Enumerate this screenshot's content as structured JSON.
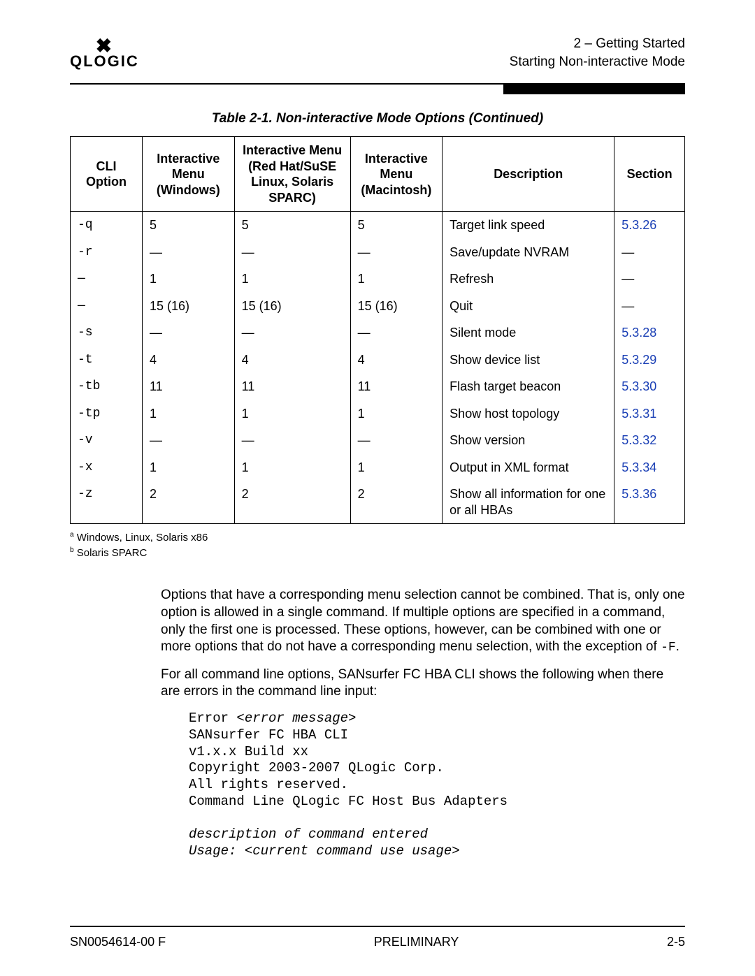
{
  "header": {
    "logo_text": "QLOGIC",
    "crumb1": "2 – Getting Started",
    "crumb2": "Starting Non-interactive Mode"
  },
  "table": {
    "caption": "Table 2-1. Non-interactive Mode Options (Continued)",
    "columns": {
      "cli1": "CLI",
      "cli2": "Option",
      "win1": "Interactive",
      "win2": "Menu",
      "win3": "(Windows)",
      "lin1": "Interactive Menu",
      "lin2": "(Red Hat/SuSE",
      "lin3": "Linux, Solaris",
      "lin4": "SPARC)",
      "mac1": "Interactive",
      "mac2": "Menu",
      "mac3": "(Macintosh)",
      "desc": "Description",
      "sec": "Section"
    },
    "rows": [
      {
        "cli": "-q",
        "win": "5",
        "lin": "5",
        "mac": "5",
        "desc": "Target link speed",
        "sec": "5.3.26",
        "link": true
      },
      {
        "cli": "-r",
        "win": "—",
        "lin": "—",
        "mac": "—",
        "desc": "Save/update NVRAM",
        "sec": "—",
        "link": false
      },
      {
        "cli": "—",
        "win": "1",
        "lin": "1",
        "mac": "1",
        "desc": "Refresh",
        "sec": "—",
        "link": false
      },
      {
        "cli": "—",
        "win": "15 (16)",
        "lin": "15 (16)",
        "mac": "15 (16)",
        "desc": "Quit",
        "sec": "—",
        "link": false
      },
      {
        "cli": "-s",
        "win": "—",
        "lin": "—",
        "mac": "—",
        "desc": "Silent mode",
        "sec": "5.3.28",
        "link": true
      },
      {
        "cli": "-t",
        "win": "4",
        "lin": "4",
        "mac": "4",
        "desc": "Show device list",
        "sec": "5.3.29",
        "link": true
      },
      {
        "cli": "-tb",
        "win": "11",
        "lin": "11",
        "mac": "11",
        "desc": "Flash target beacon",
        "sec": "5.3.30",
        "link": true
      },
      {
        "cli": "-tp",
        "win": "1",
        "lin": "1",
        "mac": "1",
        "desc": "Show host topology",
        "sec": "5.3.31",
        "link": true
      },
      {
        "cli": "-v",
        "win": "—",
        "lin": "—",
        "mac": "—",
        "desc": "Show version",
        "sec": "5.3.32",
        "link": true
      },
      {
        "cli": "-x",
        "win": "1",
        "lin": "1",
        "mac": "1",
        "desc": "Output in XML format",
        "sec": "5.3.34",
        "link": true
      },
      {
        "cli": "-z",
        "win": "2",
        "lin": "2",
        "mac": "2",
        "desc": "Show all information for one or all HBAs",
        "sec": "5.3.36",
        "link": true
      }
    ]
  },
  "footnotes": {
    "a": "Windows, Linux, Solaris x86",
    "b": "Solaris SPARC"
  },
  "paragraphs": {
    "p1_a": "Options that have a corresponding menu selection cannot be combined. That is, only one option is allowed in a single command. If multiple options are specified in a command, only the first one is processed. These options, however, can be combined with one or more options that do not have a corresponding menu selection, with the exception of ",
    "p1_code": "-F",
    "p1_b": ".",
    "p2": "For all command line options, SANsurfer FC HBA CLI shows the following when there are errors in the command line input:"
  },
  "code": {
    "l1a": "Error ",
    "l1b": "<error message>",
    "l2": "SANsurfer FC HBA CLI",
    "l3": "v1.x.x Build xx",
    "l4": "Copyright 2003-2007 QLogic Corp.",
    "l5": "All rights reserved.",
    "l6": "Command Line QLogic FC Host Bus Adapters",
    "l7": "description of command entered",
    "l8": "Usage: <current command use usage>"
  },
  "footer": {
    "left": "SN0054614-00 F",
    "center": "PRELIMINARY",
    "right": "2-5"
  }
}
